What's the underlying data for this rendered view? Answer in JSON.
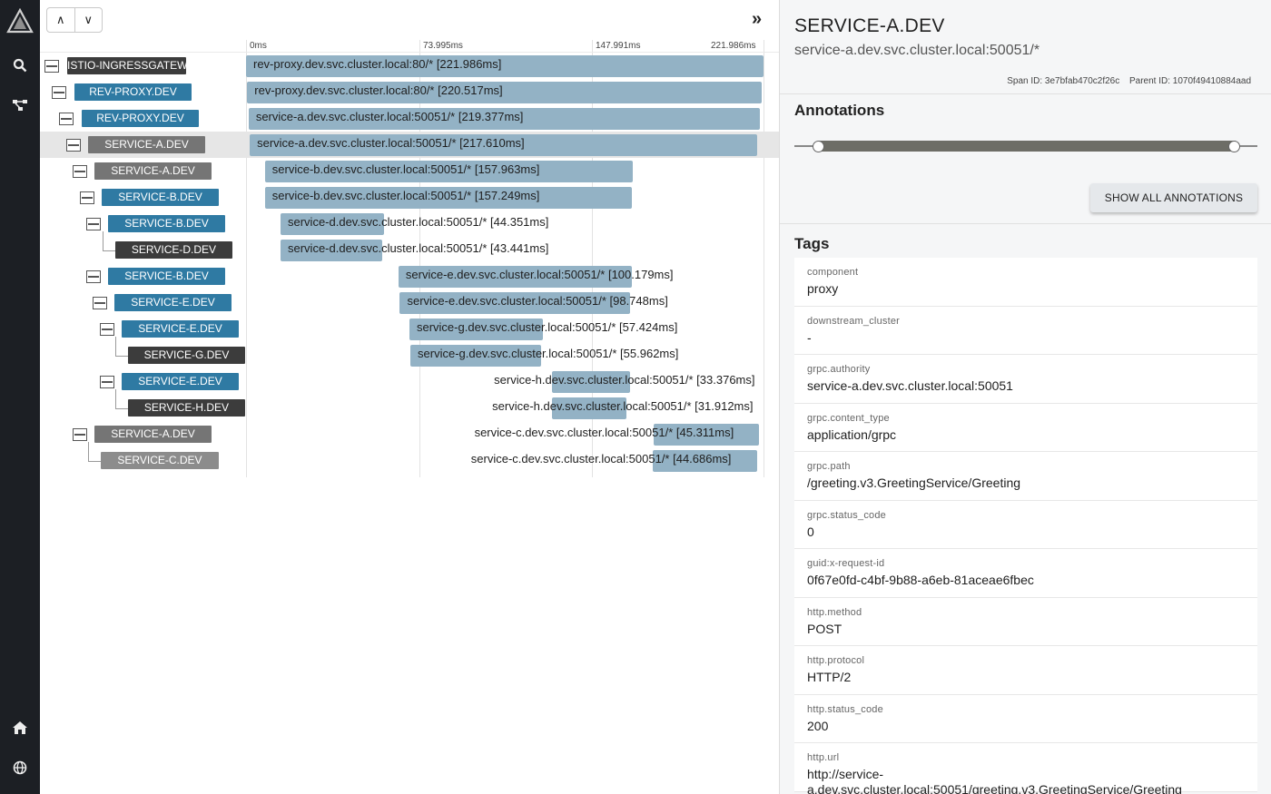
{
  "rail": {
    "icons": [
      "logo-icon",
      "search-icon",
      "topology-icon",
      "home-icon",
      "globe-icon"
    ]
  },
  "trace": {
    "nav": {
      "up_label": "∧",
      "down_label": "∨"
    },
    "collapse_label": "»",
    "ticks": [
      "0ms",
      "73.995ms",
      "147.991ms",
      "221.986ms"
    ],
    "spans": [
      {
        "service": "ISTIO-INGRESSGATEWAY",
        "label": "rev-proxy.dev.svc.cluster.local:80/* [221.986ms]",
        "start": 0,
        "duration": 221.986
      },
      {
        "service": "REV-PROXY.DEV",
        "label": "rev-proxy.dev.svc.cluster.local:80/* [220.517ms]",
        "start": 0.5,
        "duration": 220.517
      },
      {
        "service": "REV-PROXY.DEV",
        "label": "service-a.dev.svc.cluster.local:50051/* [219.377ms]",
        "start": 1.1,
        "duration": 219.377
      },
      {
        "service": "SERVICE-A.DEV",
        "label": "service-a.dev.svc.cluster.local:50051/* [217.610ms]",
        "start": 1.6,
        "duration": 217.61
      },
      {
        "service": "SERVICE-A.DEV",
        "label": "service-b.dev.svc.cluster.local:50051/* [157.963ms]",
        "start": 8.1,
        "duration": 157.963
      },
      {
        "service": "SERVICE-B.DEV",
        "label": "service-b.dev.svc.cluster.local:50051/* [157.249ms]",
        "start": 8.1,
        "duration": 157.249
      },
      {
        "service": "SERVICE-B.DEV",
        "label": "service-d.dev.svc.cluster.local:50051/* [44.351ms]",
        "start": 14.8,
        "duration": 44.351
      },
      {
        "service": "SERVICE-D.DEV",
        "label": "service-d.dev.svc.cluster.local:50051/* [43.441ms]",
        "start": 14.8,
        "duration": 43.441
      },
      {
        "service": "SERVICE-B.DEV",
        "label": "service-e.dev.svc.cluster.local:50051/* [100.179ms]",
        "start": 65.4,
        "duration": 100.179
      },
      {
        "service": "SERVICE-E.DEV",
        "label": "service-e.dev.svc.cluster.local:50051/* [98.748ms]",
        "start": 66.0,
        "duration": 98.748
      },
      {
        "service": "SERVICE-E.DEV",
        "label": "service-g.dev.svc.cluster.local:50051/* [57.424ms]",
        "start": 70.1,
        "duration": 57.424
      },
      {
        "service": "SERVICE-G.DEV",
        "label": "service-g.dev.svc.cluster.local:50051/* [55.962ms]",
        "start": 70.5,
        "duration": 55.962
      },
      {
        "service": "SERVICE-E.DEV",
        "label": "service-h.dev.svc.cluster.local:50051/* [33.376ms]",
        "start": 131.3,
        "duration": 33.376
      },
      {
        "service": "SERVICE-H.DEV",
        "label": "service-h.dev.svc.cluster.local:50051/* [31.912ms]",
        "start": 131.3,
        "duration": 31.912
      },
      {
        "service": "SERVICE-A.DEV",
        "label": "service-c.dev.svc.cluster.local:50051/* [45.311ms]",
        "start": 174.7,
        "duration": 45.311
      },
      {
        "service": "SERVICE-C.DEV",
        "label": "service-c.dev.svc.cluster.local:50051/* [44.686ms]",
        "start": 174.4,
        "duration": 44.686
      }
    ]
  },
  "details": {
    "title": "SERVICE-A.DEV",
    "subtitle": "service-a.dev.svc.cluster.local:50051/*",
    "span_id": "Span ID: 3e7bfab470c2f26c",
    "parent_id": "Parent ID: 1070f49410884aad",
    "annotations_heading": "Annotations",
    "show_all_label": "SHOW ALL ANNOTATIONS",
    "tags_heading": "Tags",
    "tags": [
      {
        "key": "component",
        "value": "proxy"
      },
      {
        "key": "downstream_cluster",
        "value": "-"
      },
      {
        "key": "grpc.authority",
        "value": "service-a.dev.svc.cluster.local:50051"
      },
      {
        "key": "grpc.content_type",
        "value": "application/grpc"
      },
      {
        "key": "grpc.path",
        "value": "/greeting.v3.GreetingService/Greeting"
      },
      {
        "key": "grpc.status_code",
        "value": "0"
      },
      {
        "key": "guid:x-request-id",
        "value": "0f67e0fd-c4bf-9b88-a6eb-81aceae6fbec"
      },
      {
        "key": "http.method",
        "value": "POST"
      },
      {
        "key": "http.protocol",
        "value": "HTTP/2"
      },
      {
        "key": "http.status_code",
        "value": "200"
      },
      {
        "key": "http.url",
        "value": "http://service-a.dev.svc.cluster.local:50051/greeting.v3.GreetingService/Greeting"
      }
    ]
  }
}
